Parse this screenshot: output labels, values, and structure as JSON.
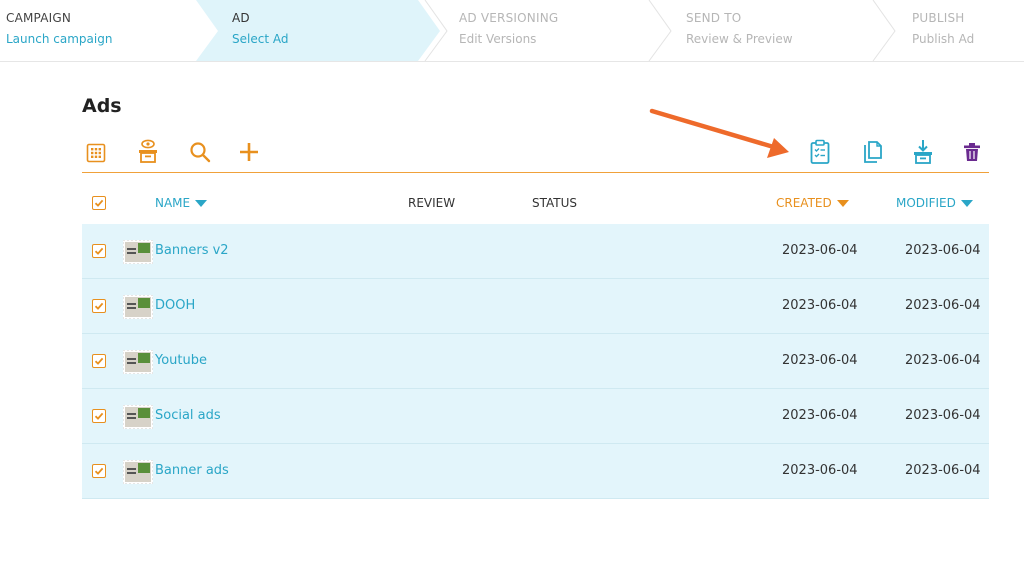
{
  "steps": [
    {
      "title": "CAMPAIGN",
      "subtitle": "Launch campaign",
      "state": "done"
    },
    {
      "title": "AD",
      "subtitle": "Select Ad",
      "state": "active"
    },
    {
      "title": "AD VERSIONING",
      "subtitle": "Edit Versions",
      "state": "todo"
    },
    {
      "title": "SEND TO",
      "subtitle": "Review & Preview",
      "state": "todo"
    },
    {
      "title": "PUBLISH",
      "subtitle": "Publish Ad",
      "state": "todo"
    }
  ],
  "page": {
    "title": "Ads"
  },
  "toolbar": {
    "left_icons": [
      "grid-view-icon",
      "preview-box-icon",
      "search-icon",
      "add-icon"
    ],
    "right_icons": [
      "clipboard-checklist-icon",
      "duplicate-icon",
      "download-box-icon",
      "trash-icon"
    ]
  },
  "table": {
    "headers": {
      "name": "NAME",
      "review": "REVIEW",
      "status": "STATUS",
      "created": "CREATED",
      "modified": "MODIFIED"
    },
    "rows": [
      {
        "name": "Banners v2",
        "created": "2023-06-04",
        "modified": "2023-06-04"
      },
      {
        "name": "DOOH",
        "created": "2023-06-04",
        "modified": "2023-06-04"
      },
      {
        "name": "Youtube",
        "created": "2023-06-04",
        "modified": "2023-06-04"
      },
      {
        "name": "Social ads",
        "created": "2023-06-04",
        "modified": "2023-06-04"
      },
      {
        "name": "Banner ads",
        "created": "2023-06-04",
        "modified": "2023-06-04"
      }
    ]
  },
  "colors": {
    "accent_blue": "#2aa6c7",
    "accent_orange": "#e8901e",
    "row_bg": "#e3f5fb",
    "active_step_bg": "#dff4fa",
    "trash_purple": "#6a2a8f",
    "annotation_arrow": "#ee6a2b"
  }
}
